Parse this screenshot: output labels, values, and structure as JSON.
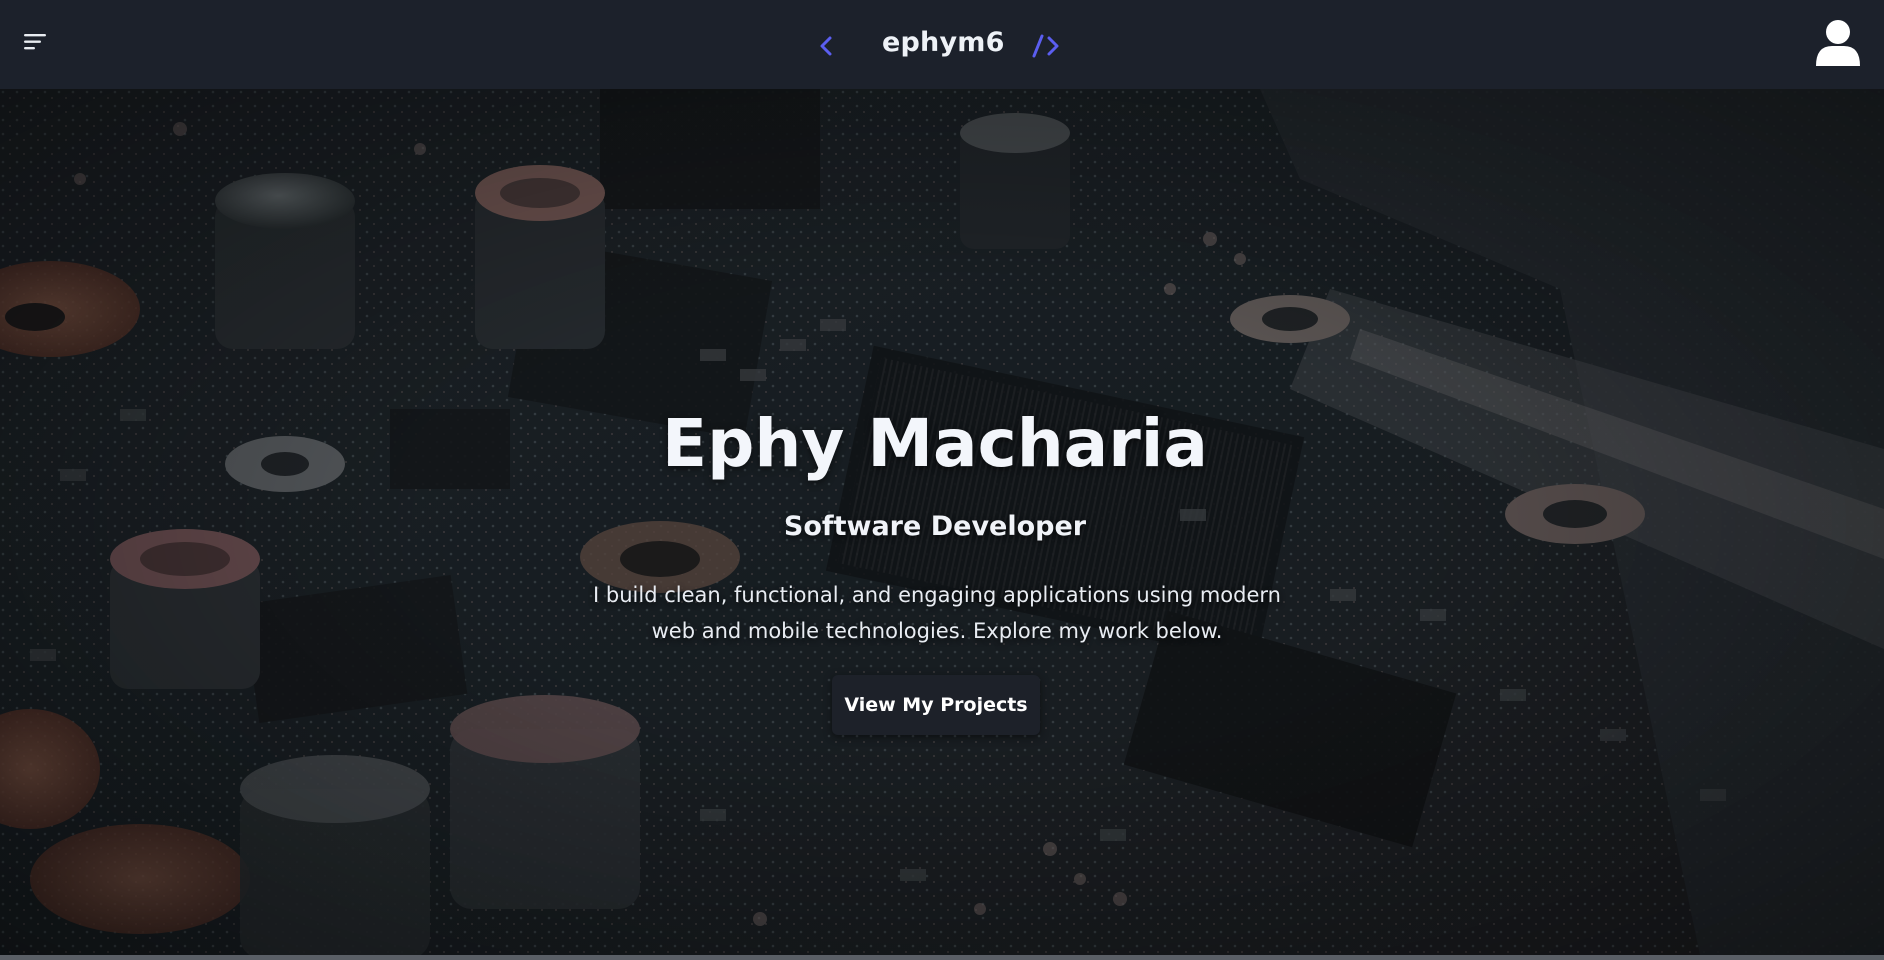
{
  "navbar": {
    "brand_name": "ephym6",
    "accent_color": "#5b5ef0"
  },
  "hero": {
    "title": "Ephy Macharia",
    "subtitle": "Software Developer",
    "description": "I build clean, functional, and engaging applications using modern web and mobile technologies. Explore my work below.",
    "cta_label": "View My Projects"
  },
  "icons": {
    "menu": "menu-icon",
    "user": "user-icon",
    "code_open": "chevron-left-icon",
    "code_close": "slash-chevron-right-icon"
  }
}
